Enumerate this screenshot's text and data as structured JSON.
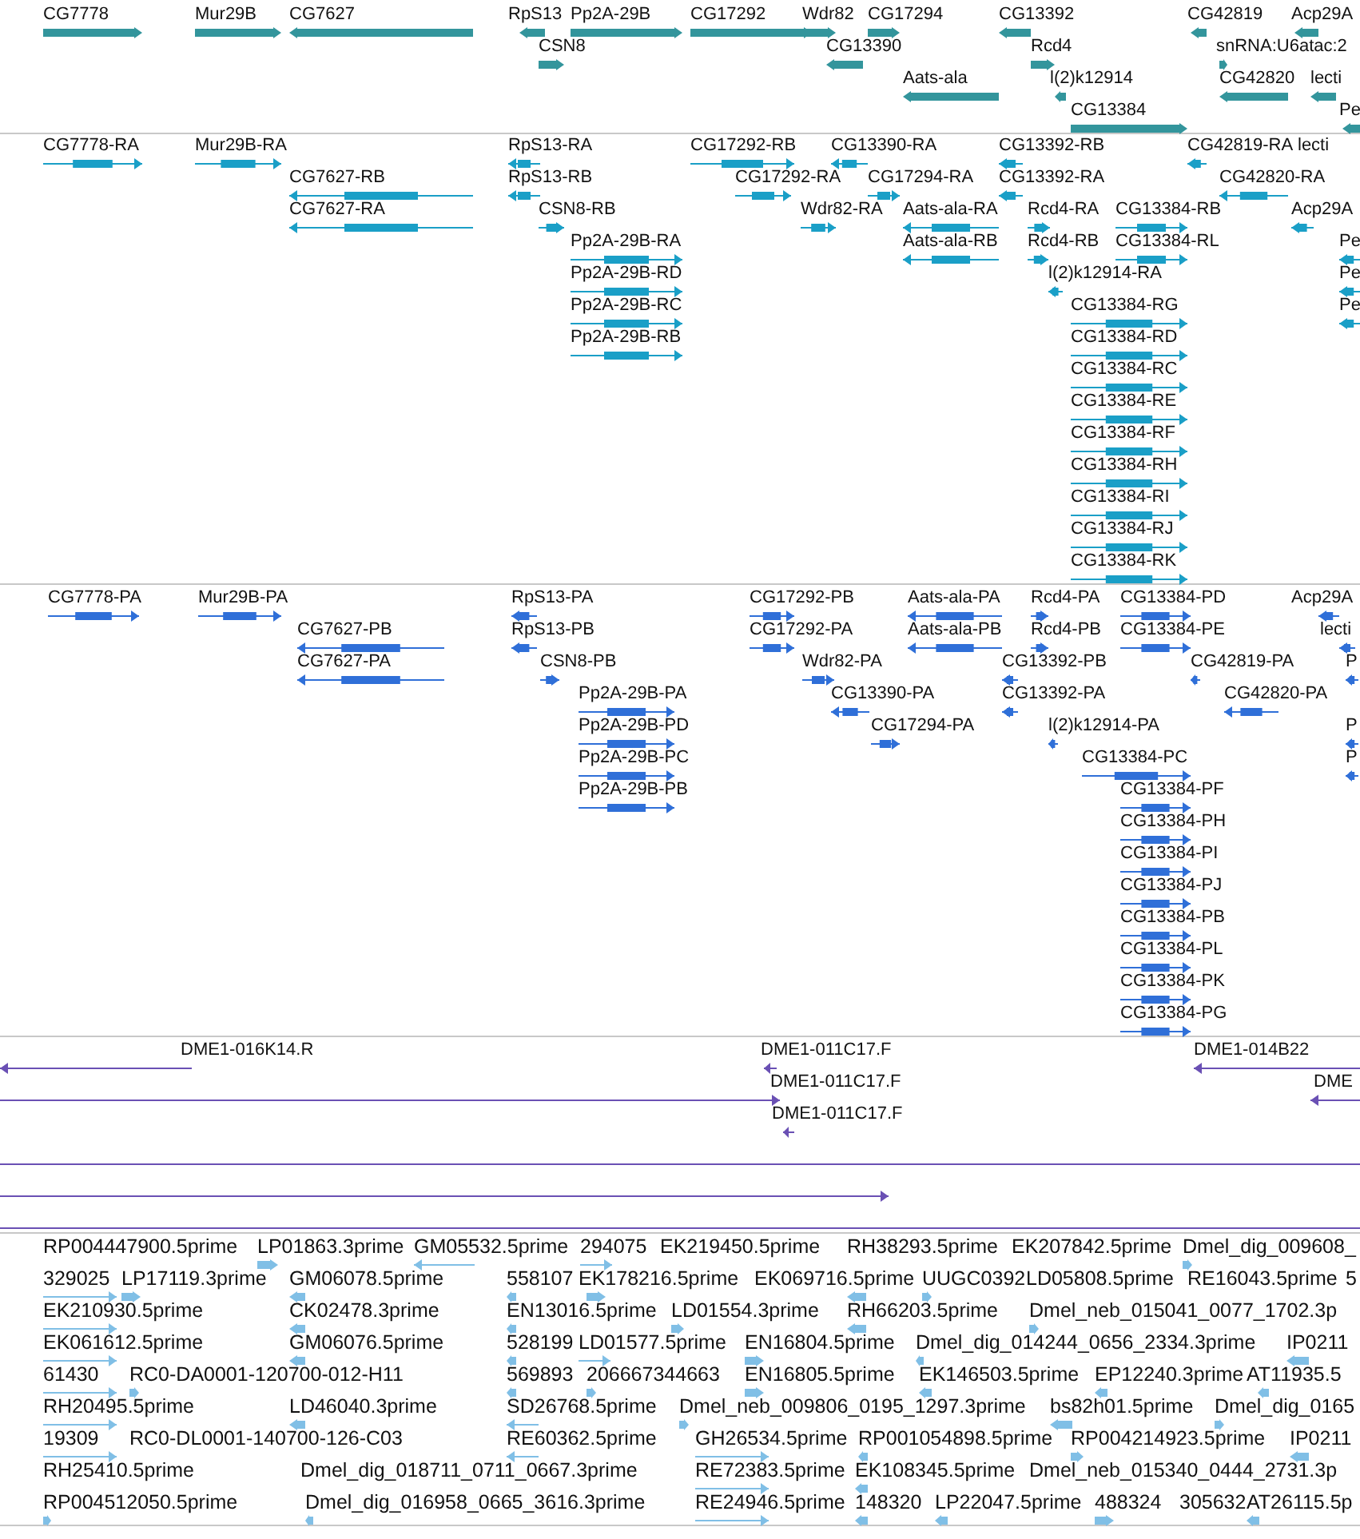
{
  "tracks": [
    {
      "kind": "gene",
      "features": [
        {
          "label": "CG7778",
          "reverse": false,
          "arrowhead": true
        },
        {
          "label": "Mur29B",
          "reverse": false,
          "arrowhead": true
        },
        {
          "label": "CG7627",
          "reverse": true,
          "arrowhead": true
        },
        {
          "label": "RpS13",
          "reverse": true,
          "arrowhead": true
        },
        {
          "label": "Pp2A-29B",
          "reverse": false,
          "arrowhead": true
        },
        {
          "label": "CG17292",
          "reverse": false,
          "arrowhead": true
        },
        {
          "label": "Wdr82",
          "reverse": false,
          "arrowhead": true
        },
        {
          "label": "CG17294",
          "reverse": false,
          "arrowhead": true
        },
        {
          "label": "CG13392",
          "reverse": true,
          "arrowhead": true
        },
        {
          "label": "CG42819",
          "reverse": true,
          "arrowhead": true
        },
        {
          "label": "Acp29A",
          "reverse": true,
          "arrowhead": true
        },
        {
          "label": "CSN8",
          "reverse": false,
          "arrowhead": true
        },
        {
          "label": "CG13390",
          "reverse": true,
          "arrowhead": true
        },
        {
          "label": "Rcd4",
          "reverse": false,
          "arrowhead": true
        },
        {
          "label": "snRNA:U6atac:2",
          "reverse": false,
          "arrowhead": true
        },
        {
          "label": "Aats-ala",
          "reverse": true,
          "arrowhead": true
        },
        {
          "label": "l(2)k12914",
          "reverse": true,
          "arrowhead": true
        },
        {
          "label": "CG42820",
          "reverse": true,
          "arrowhead": true
        },
        {
          "label": "lecti",
          "reverse": true,
          "arrowhead": true
        },
        {
          "label": "CG13384",
          "reverse": false,
          "arrowhead": true
        },
        {
          "label": "Pe",
          "reverse": true,
          "arrowhead": true
        }
      ]
    },
    {
      "kind": "transcript",
      "features": [
        {
          "label": "CG7778-RA",
          "reverse": false,
          "arrowhead": true
        },
        {
          "label": "Mur29B-RA",
          "reverse": false,
          "arrowhead": true
        },
        {
          "label": "RpS13-RA",
          "reverse": true,
          "arrowhead": true
        },
        {
          "label": "CG17292-RB",
          "reverse": false,
          "arrowhead": true
        },
        {
          "label": "CG13390-RA",
          "reverse": true,
          "arrowhead": true
        },
        {
          "label": "CG13392-RB",
          "reverse": true,
          "arrowhead": true
        },
        {
          "label": "CG42819-RA",
          "reverse": true,
          "arrowhead": true
        },
        {
          "label": "lecti"
        },
        {
          "label": "CG7627-RB",
          "reverse": true,
          "arrowhead": true
        },
        {
          "label": "RpS13-RB",
          "reverse": true,
          "arrowhead": true
        },
        {
          "label": "CG17292-RA",
          "reverse": false,
          "arrowhead": true
        },
        {
          "label": "CG17294-RA",
          "reverse": false,
          "arrowhead": true
        },
        {
          "label": "CG13392-RA",
          "reverse": true,
          "arrowhead": true
        },
        {
          "label": "CG42820-RA",
          "reverse": true,
          "arrowhead": true
        },
        {
          "label": "CG7627-RA",
          "reverse": true,
          "arrowhead": true
        },
        {
          "label": "CSN8-RB",
          "reverse": false,
          "arrowhead": true
        },
        {
          "label": "Wdr82-RA",
          "reverse": false,
          "arrowhead": true
        },
        {
          "label": "Aats-ala-RA",
          "reverse": true,
          "arrowhead": true
        },
        {
          "label": "Rcd4-RA",
          "reverse": false,
          "arrowhead": true
        },
        {
          "label": "CG13384-RB",
          "reverse": false,
          "arrowhead": true
        },
        {
          "label": "Acp29A",
          "reverse": true,
          "arrowhead": true
        },
        {
          "label": "Pp2A-29B-RA",
          "reverse": false,
          "arrowhead": true
        },
        {
          "label": "Aats-ala-RB",
          "reverse": true,
          "arrowhead": true
        },
        {
          "label": "Rcd4-RB",
          "reverse": false,
          "arrowhead": true
        },
        {
          "label": "CG13384-RL",
          "reverse": false,
          "arrowhead": true
        },
        {
          "label": "Pe",
          "reverse": true,
          "arrowhead": true
        },
        {
          "label": "Pp2A-29B-RD",
          "reverse": false,
          "arrowhead": true
        },
        {
          "label": "l(2)k12914-RA",
          "reverse": true,
          "arrowhead": true
        },
        {
          "label": "Pe",
          "reverse": true,
          "arrowhead": true
        },
        {
          "label": "Pp2A-29B-RC",
          "reverse": false,
          "arrowhead": true
        },
        {
          "label": "CG13384-RG",
          "reverse": false,
          "arrowhead": true
        },
        {
          "label": "Pe",
          "reverse": true,
          "arrowhead": true
        },
        {
          "label": "Pp2A-29B-RB",
          "reverse": false,
          "arrowhead": true
        },
        {
          "label": "CG13384-RD",
          "reverse": false,
          "arrowhead": true
        },
        {
          "label": "CG13384-RC",
          "reverse": false,
          "arrowhead": true
        },
        {
          "label": "CG13384-RE",
          "reverse": false,
          "arrowhead": true
        },
        {
          "label": "CG13384-RF",
          "reverse": false,
          "arrowhead": true
        },
        {
          "label": "CG13384-RH",
          "reverse": false,
          "arrowhead": true
        },
        {
          "label": "CG13384-RI",
          "reverse": false,
          "arrowhead": true
        },
        {
          "label": "CG13384-RJ",
          "reverse": false,
          "arrowhead": true
        },
        {
          "label": "CG13384-RK",
          "reverse": false,
          "arrowhead": true
        }
      ]
    },
    {
      "kind": "protein",
      "features": [
        {
          "label": "CG7778-PA",
          "reverse": false,
          "arrowhead": true
        },
        {
          "label": "Mur29B-PA",
          "reverse": false,
          "arrowhead": true
        },
        {
          "label": "RpS13-PA",
          "reverse": true,
          "arrowhead": true
        },
        {
          "label": "CG17292-PB",
          "reverse": false,
          "arrowhead": true
        },
        {
          "label": "Aats-ala-PA",
          "reverse": true,
          "arrowhead": true
        },
        {
          "label": "Rcd4-PA",
          "reverse": false,
          "arrowhead": true
        },
        {
          "label": "CG13384-PD",
          "reverse": false,
          "arrowhead": true
        },
        {
          "label": "Acp29A",
          "reverse": true,
          "arrowhead": true
        },
        {
          "label": "CG7627-PB",
          "reverse": true,
          "arrowhead": true
        },
        {
          "label": "RpS13-PB",
          "reverse": true,
          "arrowhead": true
        },
        {
          "label": "CG17292-PA",
          "reverse": false,
          "arrowhead": true
        },
        {
          "label": "Aats-ala-PB",
          "reverse": true,
          "arrowhead": true
        },
        {
          "label": "Rcd4-PB",
          "reverse": false,
          "arrowhead": true
        },
        {
          "label": "CG13384-PE",
          "reverse": false,
          "arrowhead": true
        },
        {
          "label": "lecti",
          "reverse": true,
          "arrowhead": true
        },
        {
          "label": "CG7627-PA",
          "reverse": true,
          "arrowhead": true
        },
        {
          "label": "CSN8-PB",
          "reverse": false,
          "arrowhead": true
        },
        {
          "label": "Wdr82-PA",
          "reverse": false,
          "arrowhead": true
        },
        {
          "label": "CG13392-PB",
          "reverse": true,
          "arrowhead": true
        },
        {
          "label": "CG42819-PA",
          "reverse": true,
          "arrowhead": true
        },
        {
          "label": "P",
          "reverse": true,
          "arrowhead": true
        },
        {
          "label": "Pp2A-29B-PA",
          "reverse": false,
          "arrowhead": true
        },
        {
          "label": "CG13390-PA",
          "reverse": true,
          "arrowhead": true
        },
        {
          "label": "CG13392-PA",
          "reverse": true,
          "arrowhead": true
        },
        {
          "label": "CG42820-PA",
          "reverse": true,
          "arrowhead": true
        },
        {
          "label": "Pp2A-29B-PD",
          "reverse": false,
          "arrowhead": true
        },
        {
          "label": "CG17294-PA",
          "reverse": false,
          "arrowhead": true
        },
        {
          "label": "l(2)k12914-PA",
          "reverse": true,
          "arrowhead": true
        },
        {
          "label": "P",
          "reverse": true,
          "arrowhead": true
        },
        {
          "label": "Pp2A-29B-PC",
          "reverse": false,
          "arrowhead": true
        },
        {
          "label": "CG13384-PC",
          "reverse": false,
          "arrowhead": true
        },
        {
          "label": "P",
          "reverse": true,
          "arrowhead": true
        },
        {
          "label": "Pp2A-29B-PB",
          "reverse": false,
          "arrowhead": true
        },
        {
          "label": "CG13384-PF",
          "reverse": false,
          "arrowhead": true
        },
        {
          "label": "CG13384-PH",
          "reverse": false,
          "arrowhead": true
        },
        {
          "label": "CG13384-PI",
          "reverse": false,
          "arrowhead": true
        },
        {
          "label": "CG13384-PJ",
          "reverse": false,
          "arrowhead": true
        },
        {
          "label": "CG13384-PB",
          "reverse": false,
          "arrowhead": true
        },
        {
          "label": "CG13384-PL",
          "reverse": false,
          "arrowhead": true
        },
        {
          "label": "CG13384-PK",
          "reverse": false,
          "arrowhead": true
        },
        {
          "label": "CG13384-PG",
          "reverse": false,
          "arrowhead": true
        }
      ]
    },
    {
      "kind": "clone",
      "features": [
        {
          "label": "DME1-016K14.R",
          "reverse": true,
          "arrowhead": true
        },
        {
          "label": "DME1-011C17.F",
          "reverse": true,
          "arrowhead": true
        },
        {
          "label": "DME1-014B22",
          "reverse": true,
          "arrowhead": true
        },
        {
          "label": "DME1-011C17.F",
          "reverse": false,
          "arrowhead": true
        },
        {
          "label": "DME",
          "reverse": true,
          "arrowhead": true
        },
        {
          "label": "DME1-011C17.F",
          "reverse": true,
          "arrowhead": true
        },
        {
          "arrowhead": false
        },
        {
          "reverse": false,
          "arrowhead": true
        },
        {
          "arrowhead": false
        }
      ]
    },
    {
      "kind": "est",
      "features": [
        {
          "label": "RP004447900.5prime"
        },
        {
          "label": "LP01863.3prime",
          "reverse": false,
          "arrowhead": true
        },
        {
          "label": "GM05532.5prime",
          "reverse": true,
          "arrowhead": true
        },
        {
          "label": "294075",
          "reverse": false,
          "arrowhead": true
        },
        {
          "label": "EK219450.5prime"
        },
        {
          "label": "RH38293.5prime"
        },
        {
          "label": "EK207842.5prime"
        },
        {
          "label": "Dmel_dig_009608_",
          "reverse": false,
          "arrowhead": true
        },
        {
          "label": "329025",
          "reverse": false,
          "arrowhead": true
        },
        {
          "label": "LP17119.3prime",
          "reverse": false,
          "arrowhead": true
        },
        {
          "label": "GM06078.5prime",
          "reverse": true,
          "arrowhead": true
        },
        {
          "label": "558107",
          "reverse": true,
          "arrowhead": true
        },
        {
          "label": "EK178216.5prime",
          "reverse": false,
          "arrowhead": true
        },
        {
          "label": "EK069716.5prime",
          "reverse": true,
          "arrowhead": true
        },
        {
          "label": "UUGC0392",
          "reverse": false,
          "arrowhead": true
        },
        {
          "label": "LD05808.5prime"
        },
        {
          "label": "RE16043.5prime"
        },
        {
          "label": "5"
        },
        {
          "label": "EK210930.5prime",
          "reverse": false,
          "arrowhead": true
        },
        {
          "label": "CK02478.3prime",
          "reverse": true,
          "arrowhead": true
        },
        {
          "label": "EN13016.5prime",
          "reverse": true,
          "arrowhead": true
        },
        {
          "label": "LD01554.3prime",
          "reverse": false,
          "arrowhead": true
        },
        {
          "label": "RH66203.5prime",
          "reverse": true,
          "arrowhead": true
        },
        {
          "label": "Dmel_neb_015041_0077_1702.3p",
          "reverse": false,
          "arrowhead": true
        },
        {
          "label": "EK061612.5prime",
          "reverse": false,
          "arrowhead": true
        },
        {
          "label": "GM06076.5prime",
          "reverse": true,
          "arrowhead": true
        },
        {
          "label": "528199",
          "reverse": true,
          "arrowhead": true
        },
        {
          "label": "LD01577.5prime",
          "reverse": false,
          "arrowhead": true
        },
        {
          "label": "EN16804.5prime",
          "reverse": false,
          "arrowhead": true
        },
        {
          "label": "Dmel_dig_014244_0656_2334.3prime",
          "reverse": true,
          "arrowhead": true
        },
        {
          "label": "IP0211",
          "reverse": true,
          "arrowhead": true
        },
        {
          "label": "61430",
          "reverse": false,
          "arrowhead": true
        },
        {
          "label": "RC0-DA0001-120700-012-H11",
          "reverse": false,
          "arrowhead": true
        },
        {
          "label": "569893",
          "reverse": true,
          "arrowhead": true
        },
        {
          "label": "206667344663",
          "reverse": false,
          "arrowhead": true
        },
        {
          "label": "EN16805.5prime",
          "reverse": false,
          "arrowhead": true
        },
        {
          "label": "EK146503.5prime",
          "reverse": true,
          "arrowhead": true
        },
        {
          "label": "EP12240.3prime",
          "reverse": true,
          "arrowhead": true
        },
        {
          "label": "AT11935.5",
          "reverse": true,
          "arrowhead": true
        },
        {
          "label": "RH20495.5prime",
          "reverse": false,
          "arrowhead": true
        },
        {
          "label": "LD46040.3prime",
          "reverse": true,
          "arrowhead": true
        },
        {
          "label": "SD26768.5prime",
          "reverse": true,
          "arrowhead": true
        },
        {
          "label": "Dmel_neb_009806_0195_1297.3prime",
          "reverse": false,
          "arrowhead": true
        },
        {
          "label": "bs82h01.5prime",
          "reverse": true,
          "arrowhead": true
        },
        {
          "label": "Dmel_dig_0165",
          "reverse": false,
          "arrowhead": true
        },
        {
          "label": "19309",
          "reverse": false,
          "arrowhead": true
        },
        {
          "label": "RC0-DL0001-140700-126-C03"
        },
        {
          "label": "RE60362.5prime",
          "reverse": true,
          "arrowhead": true
        },
        {
          "label": "GH26534.5prime",
          "reverse": false,
          "arrowhead": true
        },
        {
          "label": "RP001054898.5prime",
          "reverse": true,
          "arrowhead": true
        },
        {
          "label": "RP004214923.5prime",
          "reverse": false,
          "arrowhead": true
        },
        {
          "label": "IP0211",
          "reverse": true,
          "arrowhead": true
        },
        {
          "label": "RH25410.5prime"
        },
        {
          "label": "Dmel_dig_018711_0711_0667.3prime"
        },
        {
          "label": "RE72383.5prime",
          "reverse": false,
          "arrowhead": true
        },
        {
          "label": "EK108345.5prime",
          "reverse": true,
          "arrowhead": true
        },
        {
          "label": "Dmel_neb_015340_0444_2731.3p"
        },
        {
          "label": "RP004512050.5prime",
          "reverse": false,
          "arrowhead": true
        },
        {
          "label": "Dmel_dig_016958_0665_3616.3prime",
          "reverse": true,
          "arrowhead": true
        },
        {
          "label": "RE24946.5prime",
          "reverse": false,
          "arrowhead": true
        },
        {
          "label": "148320",
          "reverse": true,
          "arrowhead": true
        },
        {
          "label": "LP22047.5prime",
          "reverse": true,
          "arrowhead": true
        },
        {
          "label": "488324",
          "reverse": false,
          "arrowhead": true
        },
        {
          "label": "305632"
        },
        {
          "label": "AT26115.5p",
          "reverse": true,
          "arrowhead": true
        }
      ]
    }
  ]
}
